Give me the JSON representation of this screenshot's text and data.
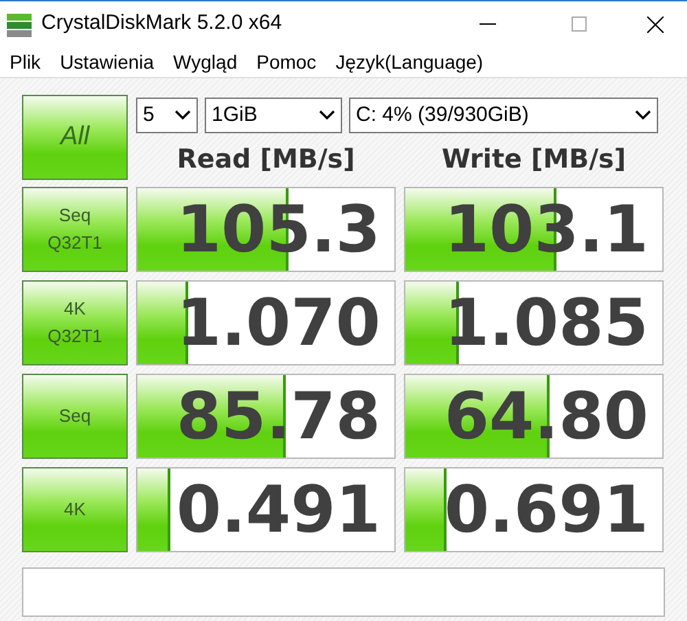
{
  "window": {
    "title": "CrystalDiskMark 5.2.0 x64"
  },
  "menu": [
    "Plik",
    "Ustawienia",
    "Wygląd",
    "Pomoc",
    "Język(Language)"
  ],
  "all_button": "All",
  "selects": [
    {
      "value": "5"
    },
    {
      "value": "1GiB"
    },
    {
      "value": "C: 4% (39/930GiB)"
    }
  ],
  "columns": [
    "Read [MB/s]",
    "Write [MB/s]"
  ],
  "rows": [
    {
      "label": "Seq\nQ32T1",
      "read": {
        "value": "105.3",
        "level": 0.59
      },
      "write": {
        "value": "103.1",
        "level": 0.59
      }
    },
    {
      "label": "4K\nQ32T1",
      "read": {
        "value": "1.070",
        "level": 0.2
      },
      "write": {
        "value": "1.085",
        "level": 0.21
      }
    },
    {
      "label": "Seq",
      "read": {
        "value": "85.78",
        "level": 0.58
      },
      "write": {
        "value": "64.80",
        "level": 0.56
      }
    },
    {
      "label": "4K",
      "read": {
        "value": "0.491",
        "level": 0.13
      },
      "write": {
        "value": "0.691",
        "level": 0.16
      }
    }
  ]
}
